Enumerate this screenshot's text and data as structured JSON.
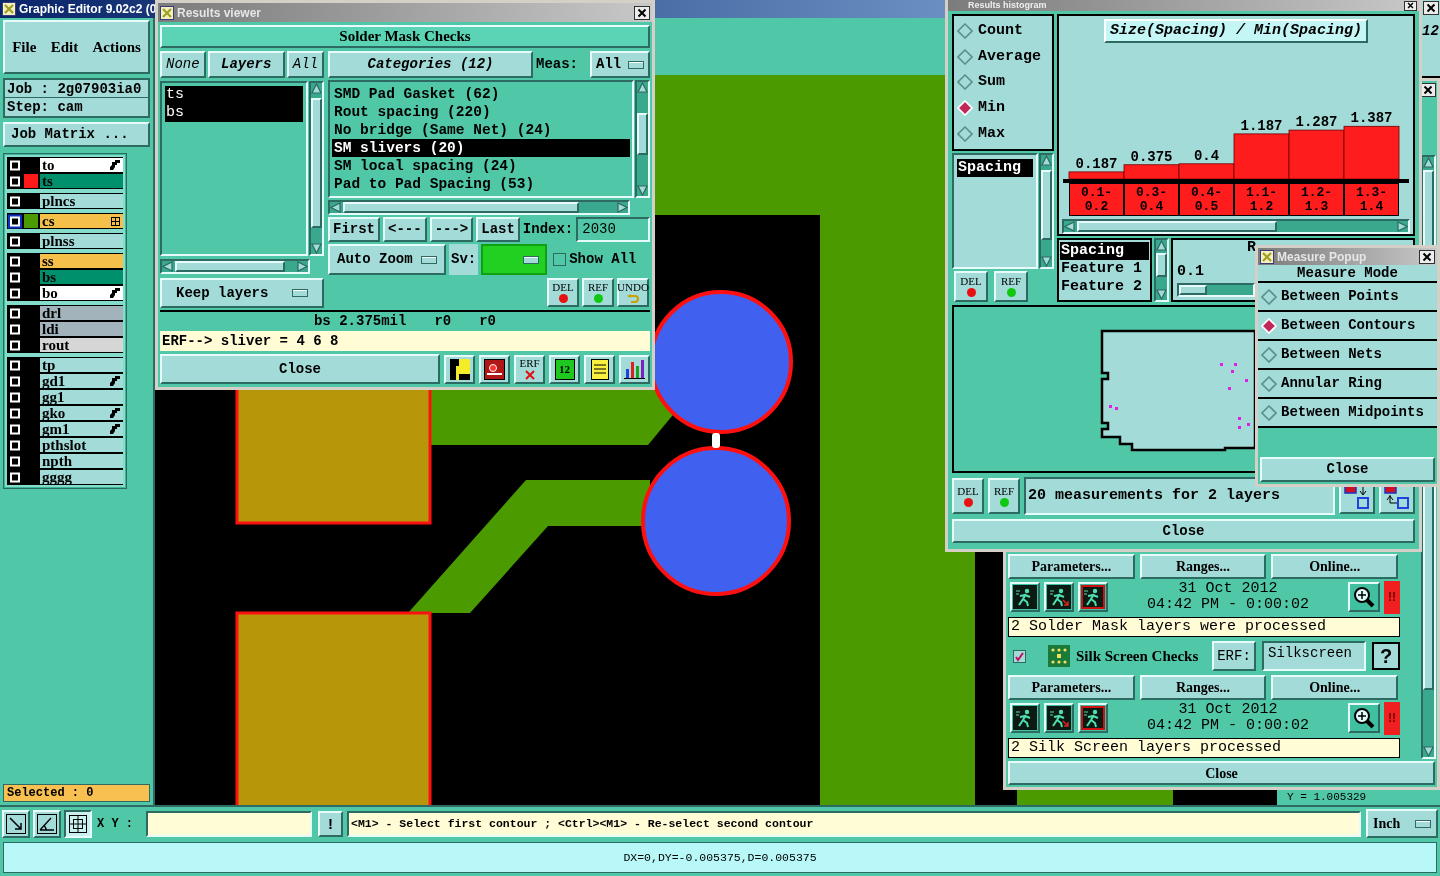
{
  "editor": {
    "title": "Graphic Editor 9.02c2 (0",
    "menu": [
      "File",
      "Edit",
      "Actions"
    ],
    "job": "Job : 2g07903ia0",
    "step": "Step: cam",
    "job_matrix": "Job Matrix ...",
    "layer_groups": [
      [
        {
          "name": "to",
          "checked": false,
          "color": "#ffffff",
          "flagged": true,
          "work_layer": false
        },
        {
          "name": "ts",
          "checked": false,
          "color": "#00906c",
          "swatch": {
            "color": "#ff1a1a"
          },
          "flagged": false,
          "work_layer": false
        }
      ],
      [
        {
          "name": "plncs",
          "checked": false,
          "color": "#a2dbd8",
          "flagged": false,
          "work_layer": false
        }
      ],
      [
        {
          "name": "cs",
          "checked": false,
          "color": "#f5c04a",
          "swatch": {
            "color": "#4a9a00"
          },
          "flagged": false,
          "work_layer": true
        }
      ],
      [
        {
          "name": "plnss",
          "checked": false,
          "color": "#a2dbd8",
          "flagged": false,
          "work_layer": false
        }
      ],
      [
        {
          "name": "ss",
          "checked": false,
          "color": "#f5c04a",
          "flagged": false,
          "work_layer": false
        },
        {
          "name": "bs",
          "checked": false,
          "color": "#00906c",
          "flagged": false,
          "work_layer": false
        },
        {
          "name": "bo",
          "checked": false,
          "color": "#ffffff",
          "flagged": true,
          "work_layer": false
        }
      ],
      [
        {
          "name": "drl",
          "checked": false,
          "color": "#a3b3bb",
          "flagged": false,
          "work_layer": false
        },
        {
          "name": "ldi",
          "checked": false,
          "color": "#a3b3bb",
          "flagged": false,
          "work_layer": false
        },
        {
          "name": "rout",
          "checked": false,
          "color": "#d6d6d6",
          "flagged": false,
          "work_layer": false
        }
      ],
      [
        {
          "name": "tp",
          "checked": false,
          "color": "#a2dbd8",
          "flagged": false,
          "work_layer": false
        },
        {
          "name": "gd1",
          "checked": false,
          "color": "#a2dbd8",
          "flagged": true,
          "work_layer": false
        },
        {
          "name": "gg1",
          "checked": false,
          "color": "#a2dbd8",
          "flagged": false,
          "work_layer": false
        },
        {
          "name": "gko",
          "checked": false,
          "color": "#a2dbd8",
          "flagged": true,
          "work_layer": false
        },
        {
          "name": "gm1",
          "checked": false,
          "color": "#a2dbd8",
          "flagged": true,
          "work_layer": false
        },
        {
          "name": "pthslot",
          "checked": false,
          "color": "#a2dbd8",
          "flagged": false,
          "work_layer": false
        },
        {
          "name": "npth",
          "checked": false,
          "color": "#a2dbd8",
          "flagged": false,
          "work_layer": false
        },
        {
          "name": "gggg",
          "checked": false,
          "color": "#a2dbd8",
          "flagged": false,
          "work_layer": false
        }
      ]
    ],
    "selection": "Selected : 0"
  },
  "toolbar": {
    "xy_label": "X Y :",
    "alert": "!",
    "message": "<M1> - Select first contour ; <Ctrl><M1> - Re-select second contour",
    "units": "Inch"
  },
  "status_bar": {
    "text": "DX=0,DY=-0.005375,D=0.005375"
  },
  "results_viewer": {
    "title": "Results viewer",
    "heading": "Solder Mask Checks",
    "layer_buttons": [
      {
        "label": "None",
        "kind": "option"
      },
      {
        "label": "Layers",
        "kind": "title"
      },
      {
        "label": "All",
        "kind": "option"
      }
    ],
    "layers": [
      {
        "name": "ts",
        "selected": true
      },
      {
        "name": "bs",
        "selected": true
      }
    ],
    "keep_layers": "Keep layers",
    "categories_button": "Categories (12)",
    "meas_label": "Meas:",
    "meas_value": "All",
    "categories": [
      {
        "label": "SMD Pad Gasket (62)",
        "selected": false
      },
      {
        "label": "Rout spacing (220)",
        "selected": false
      },
      {
        "label": "No bridge (Same Net) (24)",
        "selected": false
      },
      {
        "label": "SM slivers (20)",
        "selected": true
      },
      {
        "label": "SM local spacing (24)",
        "selected": false
      },
      {
        "label": "Pad to Pad Spacing (53)",
        "selected": false
      }
    ],
    "nav_buttons": [
      "First",
      "<---",
      "--->",
      "Last"
    ],
    "index_label": "Index:",
    "index_value": "2030",
    "zoom_mode": "Auto Zoom",
    "sv": {
      "label": "Sv:",
      "color": "#22d022"
    },
    "show_all": {
      "label": "Show All",
      "checked": false
    },
    "action_buttons": [
      {
        "label": "DEL",
        "kind": "dot",
        "color": "#e81010"
      },
      {
        "label": "REF",
        "kind": "dot",
        "color": "#10c810"
      },
      {
        "label": "UNDO",
        "kind": "undo"
      }
    ],
    "measurement": [
      "bs 2.375mil",
      "r0",
      "r0"
    ],
    "erf_line": "ERF--> sliver = 4 6 8",
    "close": "Close",
    "tools": [
      {
        "kind": "highlight"
      },
      {
        "kind": "marker"
      },
      {
        "kind": "erf",
        "label": "ERF"
      },
      {
        "kind": "page",
        "label": "12"
      },
      {
        "kind": "notes"
      },
      {
        "kind": "chart"
      }
    ]
  },
  "histogram": {
    "title": "Results histogram",
    "modes": [
      {
        "label": "Count",
        "selected": false
      },
      {
        "label": "Average",
        "selected": false
      },
      {
        "label": "Sum",
        "selected": false
      },
      {
        "label": "Min",
        "selected": true
      },
      {
        "label": "Max",
        "selected": false
      }
    ],
    "measures": [
      {
        "label": "Spacing",
        "selected": true
      }
    ],
    "list_buttons": [
      {
        "label": "DEL",
        "kind": "dot",
        "color": "#e81010"
      },
      {
        "label": "REF",
        "kind": "dot",
        "color": "#10c810"
      }
    ],
    "chart_data": {
      "type": "bar",
      "title": "Size(Spacing) / Min(Spacing)",
      "categories": [
        "0.1-0.2",
        "0.3-0.4",
        "0.4-0.5",
        "1.1-1.2",
        "1.2-1.3",
        "1.3-1.4"
      ],
      "values": [
        0.187,
        0.375,
        0.4,
        1.187,
        1.287,
        1.387
      ],
      "data_labels": true
    },
    "fields": [
      {
        "label": "Spacing",
        "selected": true
      },
      {
        "label": "Feature 1",
        "selected": false
      },
      {
        "label": "Feature 2",
        "selected": false
      }
    ],
    "range": {
      "label": "R",
      "reading": "0.1",
      "level": 0
    },
    "map_buttons": [
      {
        "label": "DEL",
        "kind": "dot",
        "color": "#e81010"
      },
      {
        "label": "REF",
        "kind": "dot",
        "color": "#10c810"
      }
    ],
    "summary": "20 measurements for 2 layers",
    "close": "Close"
  },
  "measure_popup": {
    "title": "Measure Popup",
    "heading": "Measure Mode",
    "modes": [
      {
        "label": "Between Points",
        "selected": false
      },
      {
        "label": "Between Contours",
        "selected": true
      },
      {
        "label": "Between Nets",
        "selected": false
      },
      {
        "label": "Annular Ring",
        "selected": false
      },
      {
        "label": "Between Midpoints",
        "selected": false
      }
    ],
    "close": "Close"
  },
  "checks": {
    "sections": [
      {
        "buttons": [
          "Parameters...",
          "Ranges...",
          "Online..."
        ],
        "date": "31 Oct 2012",
        "time": "04:42 PM - 0:00:02",
        "alert": "!!",
        "result": "2 Solder Mask layers were processed"
      },
      {
        "title": "Silk Screen Checks",
        "checked": true,
        "erf_label": "ERF:",
        "erf_value": "Silkscreen",
        "help": "?",
        "buttons": [
          "Parameters...",
          "Ranges...",
          "Online..."
        ],
        "date": "31 Oct 2012",
        "time": "04:42 PM - 0:00:02",
        "alert": "!!",
        "result": "2 Silk Screen layers processed"
      }
    ],
    "close": "Close"
  },
  "background": {
    "corner_text": "12",
    "coordinate": "Y = 1.005329"
  }
}
